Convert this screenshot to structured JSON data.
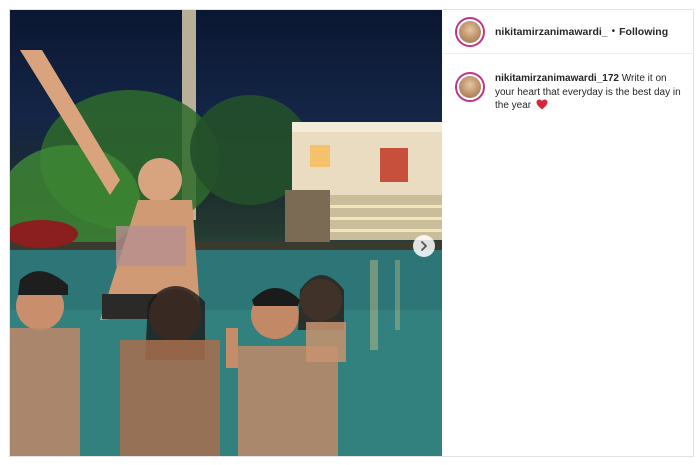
{
  "header": {
    "username": "nikitamirzanimawardi_",
    "separator": "•",
    "follow_status": "Following"
  },
  "caption": {
    "username": "nikitamirzanimawardi_172",
    "text": "Write it on your heart that everyday is the best day in the year",
    "emoji_icon": "red-heart-icon"
  },
  "carousel": {
    "next_icon": "chevron-right-icon"
  },
  "colors": {
    "story_ring": "#c13584",
    "heart": "#d62839",
    "text": "#262626"
  }
}
